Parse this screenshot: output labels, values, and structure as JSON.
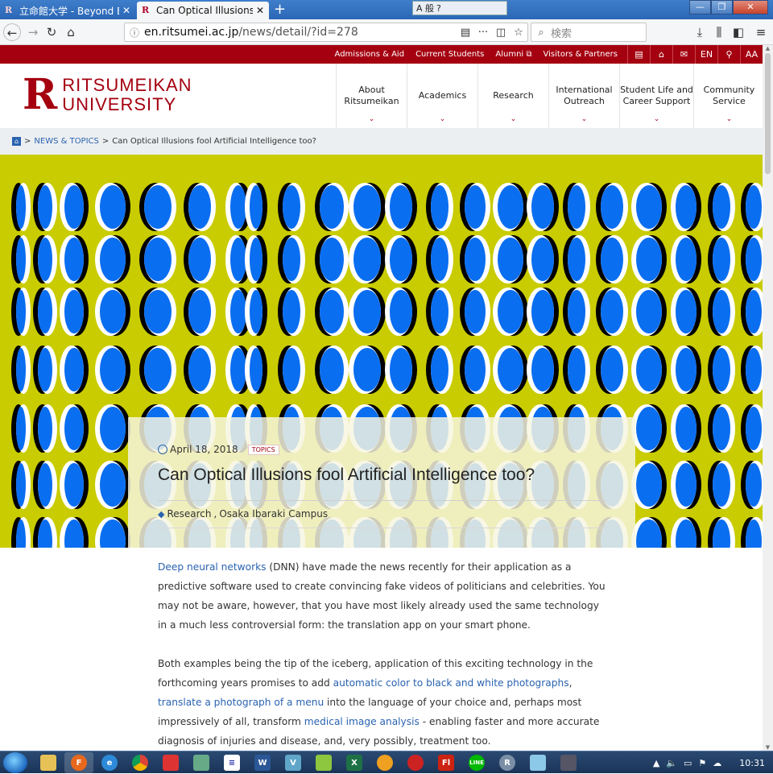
{
  "browser": {
    "tabs": [
      {
        "title": "立命館大学 - Beyond Bo",
        "close": "✕"
      },
      {
        "title": "Can Optical Illusions fo",
        "close": "✕"
      }
    ],
    "new_tab": "+",
    "ime_label": "A 般",
    "url_domain": "en.ritsumei.ac.jp",
    "url_path": "/news/detail/?id=278",
    "search_placeholder": "検索"
  },
  "site": {
    "top_links": [
      "Admissions & Aid",
      "Current Students",
      "Alumni",
      "Visitors & Partners"
    ],
    "lang": "EN",
    "font_size": "AA",
    "logo_line1": "RITSUMEIKAN",
    "logo_line2": "UNIVERSITY",
    "nav": [
      {
        "line1": "About",
        "line2": "Ritsumeikan"
      },
      {
        "line1": "Academics",
        "line2": ""
      },
      {
        "line1": "Research",
        "line2": ""
      },
      {
        "line1": "International",
        "line2": "Outreach"
      },
      {
        "line1": "Student Life and",
        "line2": "Career Support"
      },
      {
        "line1": "Community",
        "line2": "Service"
      }
    ],
    "breadcrumb": {
      "sep": ">",
      "section": "NEWS & TOPICS",
      "current": "Can Optical Illusions fool Artificial Intelligence too?"
    }
  },
  "article": {
    "date": "April 18, 2018",
    "category": "TOPICS",
    "title": "Can Optical Illusions fool Artificial Intelligence too?",
    "tag1": "Research",
    "tag2": "Osaka Ibaraki Campus",
    "p1_link": "Deep neural networks",
    "p1_text": " (DNN) have made the news recently for their application as a predictive software used to create convincing fake videos of politicians and celebrities. You may not be aware, however, that you have most likely already used the same technology in a much less controversial form: the translation app on your smart phone.",
    "p2_a": "Both examples being the tip of the iceberg, application of this exciting technology in the forthcoming years promises to add ",
    "p2_link1": "automatic color to black and white photographs",
    "p2_b": ", ",
    "p2_link2": "translate a photograph of a menu",
    "p2_c": " into the language of your choice and, perhaps most impressively of all, transform ",
    "p2_link3": "medical image analysis",
    "p2_d": " - enabling faster and more accurate diagnosis of injuries and disease, and, very possibly, treatment too."
  },
  "taskbar": {
    "apps": [
      "F",
      "e",
      "G",
      "W",
      "Fl",
      "LINE",
      "R"
    ],
    "clock": "10:31"
  },
  "colors": {
    "brand_red": "#a4000f",
    "link_blue": "#2a63b0",
    "illusion_yellow": "#c9cc00",
    "illusion_blue": "#0a6ef0"
  }
}
